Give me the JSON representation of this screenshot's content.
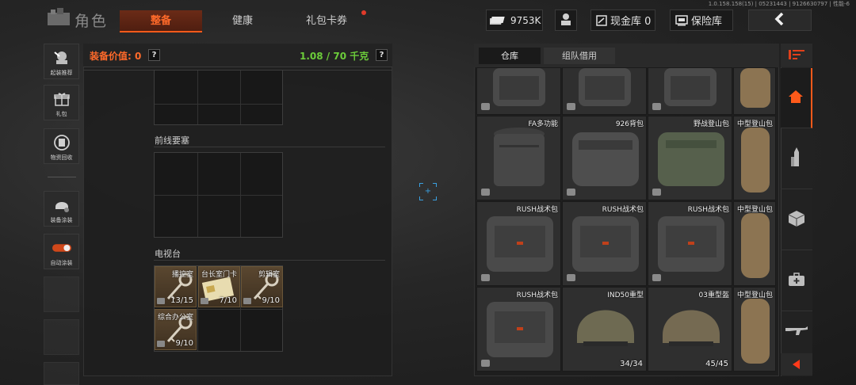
{
  "version": "1.0.158.158(15) | 05231443 | 9126630797 | 性能-6",
  "header": {
    "title": "角色",
    "tabs": [
      {
        "label": "整备",
        "active": true
      },
      {
        "label": "健康",
        "active": false
      },
      {
        "label": "礼包卡券",
        "active": false
      }
    ],
    "money": "9753K",
    "cash_vault": "现金库 0",
    "safe_vault": "保险库"
  },
  "sidebar": {
    "items": [
      {
        "label": "起装推荐",
        "icon": "recommend-loadout-icon"
      },
      {
        "label": "礼包",
        "icon": "gift-icon"
      },
      {
        "label": "物资回收",
        "icon": "recycle-icon"
      },
      {
        "label": "装备涂装",
        "icon": "paint-helmet-icon"
      },
      {
        "label": "自动涂装",
        "icon": "toggle-icon"
      }
    ]
  },
  "loadout": {
    "equipment_value_label": "装备价值: 0",
    "help": "?",
    "weight": "1.08 / 70 千克",
    "sections": [
      {
        "label": "前线要塞"
      },
      {
        "label": "电视台"
      }
    ],
    "keys": [
      {
        "name": "播控室",
        "count": "13/15"
      },
      {
        "name": "台长室门卡",
        "count": "7/10"
      },
      {
        "name": "剪辑室",
        "count": "9/10"
      },
      {
        "name": "综合办公室",
        "count": "9/10"
      }
    ]
  },
  "warehouse": {
    "tabs": [
      {
        "label": "仓库",
        "active": true
      },
      {
        "label": "组队借用",
        "active": false
      }
    ],
    "rows": [
      [
        {
          "name": "",
          "count": ""
        },
        {
          "name": "",
          "count": ""
        },
        {
          "name": "",
          "count": ""
        },
        {
          "name": "",
          "count": ""
        }
      ],
      [
        {
          "name": "FA多功能",
          "count": ""
        },
        {
          "name": "926背包",
          "count": ""
        },
        {
          "name": "野战登山包",
          "count": ""
        },
        {
          "name": "中型登山包",
          "count": ""
        }
      ],
      [
        {
          "name": "RUSH战术包",
          "count": ""
        },
        {
          "name": "RUSH战术包",
          "count": ""
        },
        {
          "name": "RUSH战术包",
          "count": ""
        },
        {
          "name": "中型登山包",
          "count": ""
        }
      ],
      [
        {
          "name": "RUSH战术包",
          "count": ""
        },
        {
          "name": "IND50重型",
          "count": "34/34"
        },
        {
          "name": "03重型盔",
          "count": "45/45"
        },
        {
          "name": "中型登山包",
          "count": ""
        }
      ]
    ]
  },
  "colors": {
    "accent": "#ff5a1a",
    "weight_green": "#6ccc3a",
    "key_brown": "#5a4730"
  }
}
